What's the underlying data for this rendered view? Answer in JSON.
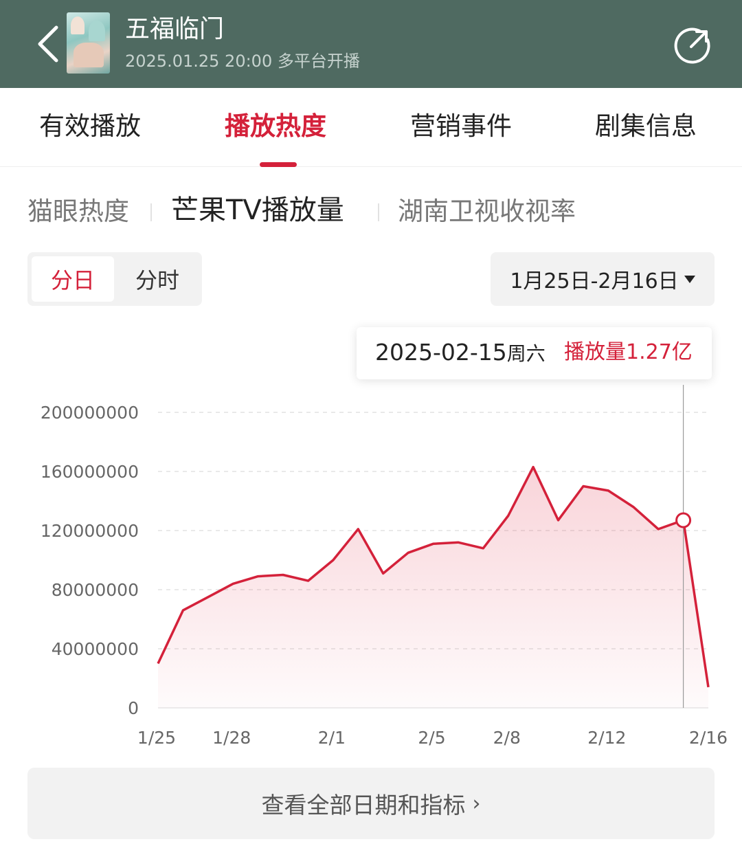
{
  "header": {
    "title": "五福临门",
    "subtitle": "2025.01.25 20:00 多平台开播"
  },
  "tabs": [
    {
      "label": "有效播放",
      "active": false
    },
    {
      "label": "播放热度",
      "active": true
    },
    {
      "label": "营销事件",
      "active": false
    },
    {
      "label": "剧集信息",
      "active": false
    }
  ],
  "subtabs": [
    {
      "label": "猫眼热度",
      "active": false
    },
    {
      "label": "芒果TV播放量",
      "active": true
    },
    {
      "label": "湖南卫视收视率",
      "active": false
    }
  ],
  "segment": {
    "day": "分日",
    "hour": "分时"
  },
  "date_range": "1月25日-2月16日",
  "tooltip": {
    "date": "2025-02-15",
    "weekday": "周六",
    "value": "播放量1.27亿"
  },
  "bottom_button": "查看全部日期和指标",
  "colors": {
    "accent": "#d4213a",
    "header_bg": "#4f6a61"
  },
  "chart_data": {
    "type": "area",
    "x": [
      "1/25",
      "1/26",
      "1/27",
      "1/28",
      "1/29",
      "1/30",
      "1/31",
      "2/1",
      "2/2",
      "2/3",
      "2/4",
      "2/5",
      "2/6",
      "2/7",
      "2/8",
      "2/9",
      "2/10",
      "2/11",
      "2/12",
      "2/13",
      "2/14",
      "2/15",
      "2/16"
    ],
    "x_tick_labels": [
      "1/25",
      "1/28",
      "2/1",
      "2/5",
      "2/8",
      "2/12",
      "2/16"
    ],
    "series": [
      {
        "values": [
          30000000,
          66000000,
          75000000,
          84000000,
          89000000,
          90000000,
          86000000,
          100000000,
          121000000,
          91000000,
          105000000,
          111000000,
          112000000,
          108000000,
          130000000,
          163000000,
          127000000,
          150000000,
          147000000,
          136000000,
          121000000,
          127000000,
          14000000
        ]
      }
    ],
    "y_ticks": [
      "200000000",
      "160000000",
      "120000000",
      "80000000",
      "40000000",
      "0"
    ],
    "ylim": [
      0,
      200000000
    ],
    "grid": true,
    "highlight": "2/15"
  }
}
